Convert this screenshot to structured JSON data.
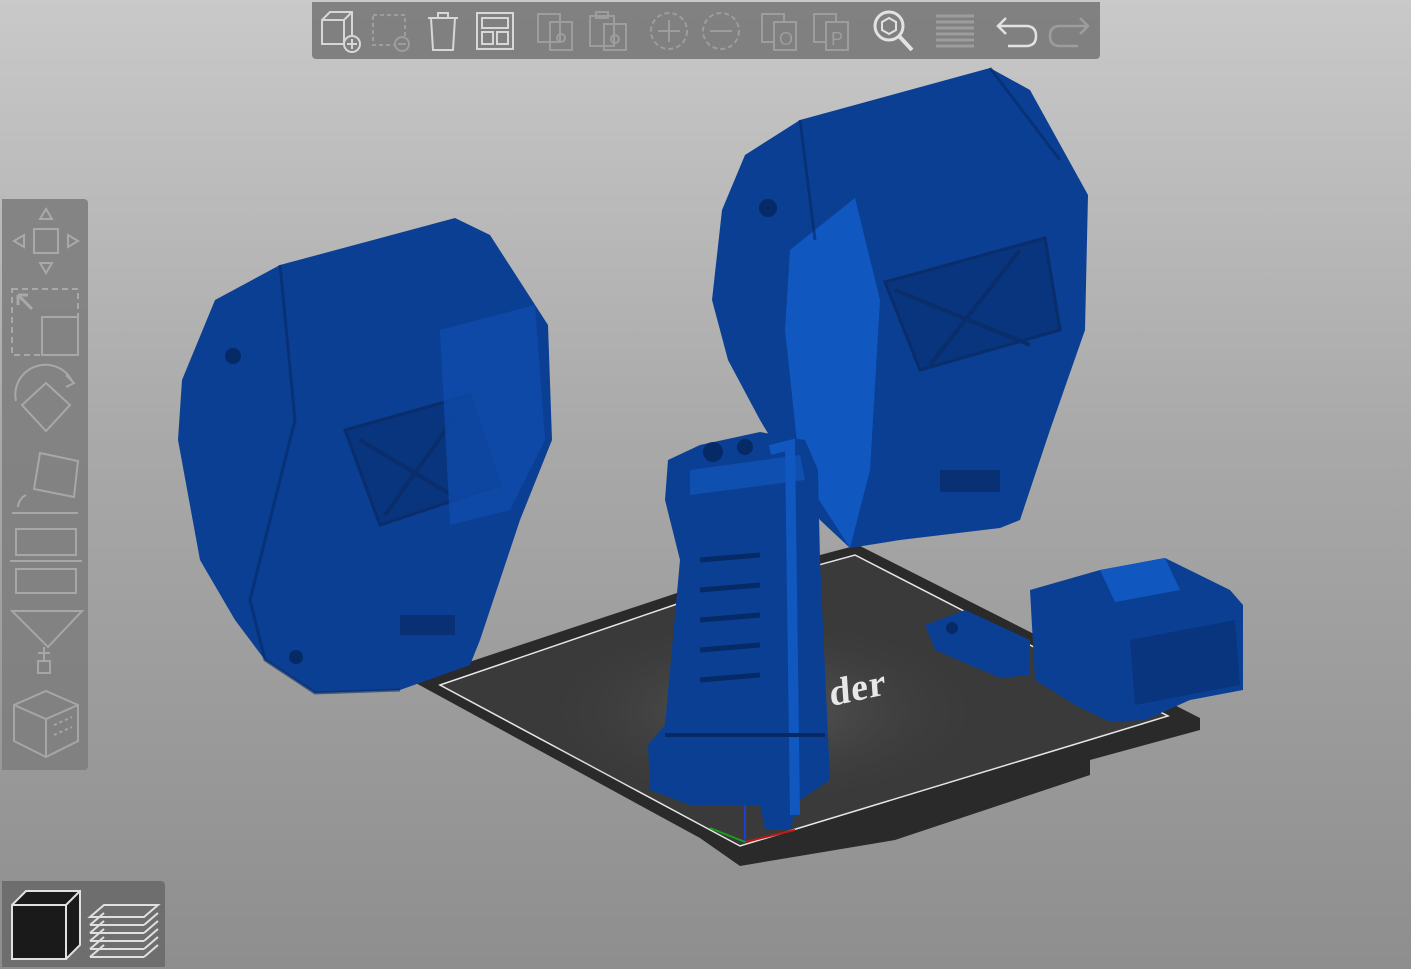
{
  "colors": {
    "model": "#0b3f94",
    "model_dark": "#062a66",
    "bed": "#333333",
    "toolbar_bg": "#7b7b7b",
    "icon": "#d9d9d9",
    "icon_disabled": "#9a9a9a"
  },
  "toolbar": {
    "buttons": [
      {
        "icon": "add-object-icon",
        "enabled": true
      },
      {
        "icon": "delete-selected-icon",
        "enabled": false
      },
      {
        "icon": "delete-all-icon",
        "enabled": true
      },
      {
        "icon": "arrange-icon",
        "enabled": true
      },
      {
        "icon": "copy-icon",
        "enabled": false
      },
      {
        "icon": "paste-icon",
        "enabled": false
      },
      {
        "icon": "add-instance-icon",
        "enabled": false
      },
      {
        "icon": "remove-instance-icon",
        "enabled": false
      },
      {
        "icon": "split-objects-icon",
        "enabled": false
      },
      {
        "icon": "split-parts-icon",
        "enabled": false
      },
      {
        "icon": "search-icon",
        "enabled": true
      },
      {
        "icon": "layers-editing-icon",
        "enabled": false
      },
      {
        "icon": "undo-icon",
        "enabled": true
      },
      {
        "icon": "redo-icon",
        "enabled": false
      }
    ]
  },
  "gizmos": [
    "move-icon",
    "scale-icon",
    "rotate-icon",
    "place-on-face-icon",
    "cut-icon",
    "paint-supports-icon",
    "seam-painting-icon"
  ],
  "view_toggle": [
    "3d-view-icon",
    "preview-icon"
  ],
  "bed": {
    "label": "der"
  }
}
